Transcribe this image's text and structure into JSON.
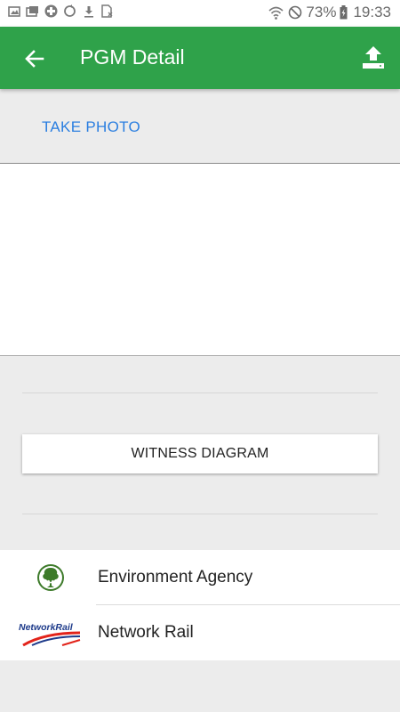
{
  "status_bar": {
    "battery": "73%",
    "time": "19:33",
    "left_icons": [
      "gallery-icon",
      "screen-icon",
      "health-icon",
      "sync-icon",
      "download-icon",
      "sim-icon"
    ],
    "right_icons": [
      "wifi-icon",
      "do-not-disturb-icon",
      "battery-icon"
    ]
  },
  "toolbar": {
    "title": "PGM Detail",
    "background": "#2fa24a"
  },
  "photo": {
    "take_photo_label": "TAKE PHOTO",
    "accent": "#2a7ee0"
  },
  "witness_button": {
    "label": "WITNESS DIAGRAM"
  },
  "links": [
    {
      "label": "Environment Agency",
      "icon": "environment-agency-logo"
    },
    {
      "label": "Network Rail",
      "icon": "network-rail-logo",
      "logo_text": "NetworkRail"
    }
  ]
}
